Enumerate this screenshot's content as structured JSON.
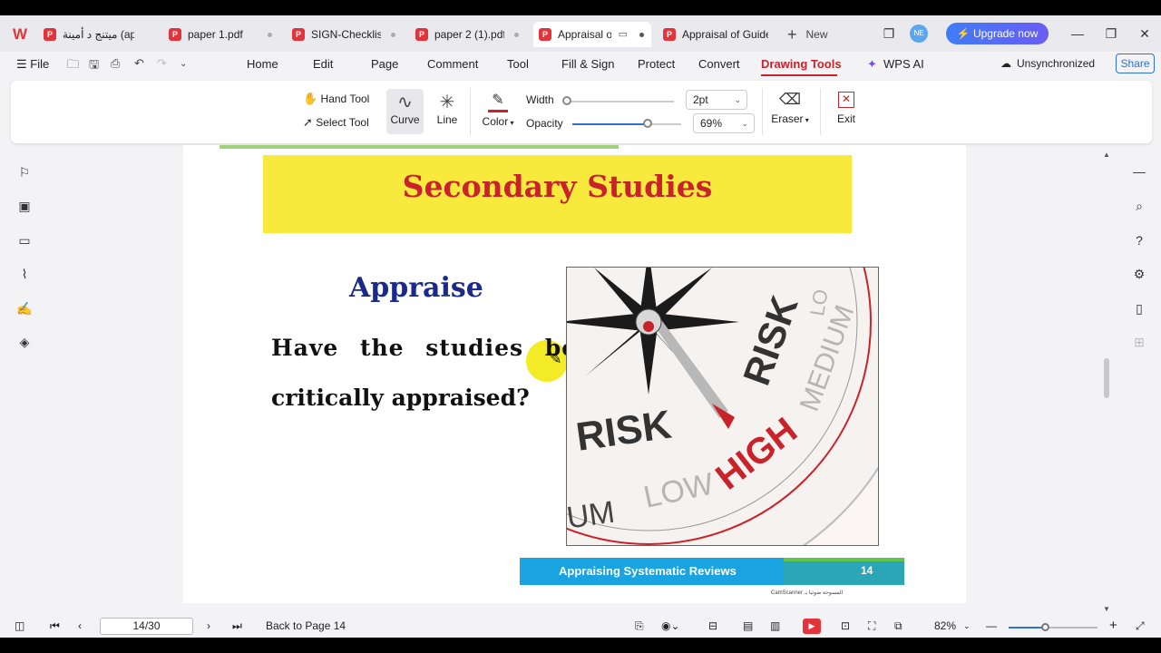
{
  "tabs": [
    {
      "label": "ميتنج د أمينة (appra",
      "active": false
    },
    {
      "label": "paper 1.pdf",
      "active": false
    },
    {
      "label": "SIGN-Checklist",
      "active": false
    },
    {
      "label": "paper 2 (1).pdf",
      "active": false
    },
    {
      "label": "Appraisal o",
      "active": true
    },
    {
      "label": "Appraisal of Guide",
      "active": false
    }
  ],
  "new_tab_label": "New",
  "avatar_initials": "NE",
  "upgrade_label": "Upgrade now",
  "menu": {
    "file": "File",
    "items": [
      "Home",
      "Edit",
      "Page",
      "Comment",
      "Tool",
      "Fill & Sign",
      "Protect",
      "Convert",
      "Drawing Tools",
      "WPS AI"
    ],
    "active": "Drawing Tools",
    "sync_status": "Unsynchronized",
    "share": "Share"
  },
  "ribbon": {
    "hand_tool": "Hand Tool",
    "select_tool": "Select Tool",
    "curve": "Curve",
    "line": "Line",
    "color": "Color",
    "color_value": "#d0202a",
    "width_label": "Width",
    "width_value": "2pt",
    "opacity_label": "Opacity",
    "opacity_value": "69%",
    "width_level": 0.02,
    "opacity_level": 0.69,
    "eraser": "Eraser",
    "exit": "Exit"
  },
  "document": {
    "banner_title": "Secondary Studies",
    "heading": "Appraise",
    "question_line1": "Have the studies been",
    "question_line2": "critically appraised?",
    "image_words": [
      "RISK",
      "RISK",
      "HIGH",
      "MEDIUM",
      "LOW",
      "UM",
      "LO"
    ],
    "footer_text": "Appraising Systematic Reviews",
    "footer_page": "14",
    "scanner_note": "CamScanner المسوحة ضوئيا بـ"
  },
  "status": {
    "page_current": "14/30",
    "back_to_page": "Back to Page 14",
    "zoom": "82%",
    "zoom_level": 0.41
  }
}
